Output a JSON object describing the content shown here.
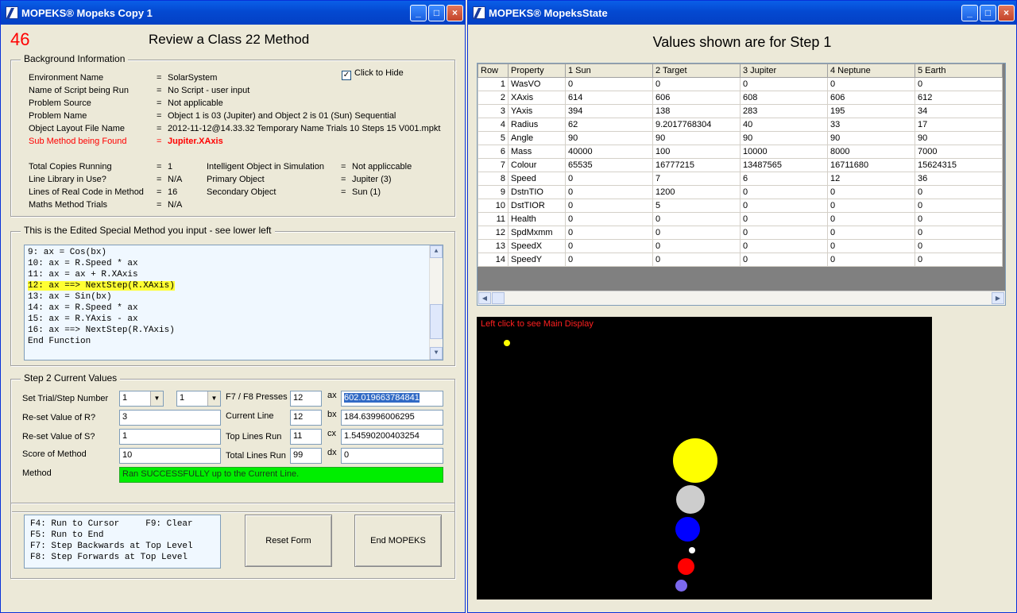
{
  "left_window": {
    "title": "MOPEKS® Mopeks Copy 1",
    "counter": "46",
    "heading": "Review a Class 22 Method",
    "background": {
      "legend": "Background Information",
      "hide_label": "Click to Hide",
      "rows": [
        {
          "label": "Environment Name",
          "value": "SolarSystem"
        },
        {
          "label": "Name of Script being Run",
          "value": "No Script - user input"
        },
        {
          "label": "Problem Source",
          "value": "Not applicable"
        },
        {
          "label": "Problem Name",
          "value": "Object 1 is 03 (Jupiter) and Object 2 is 01 (Sun) Sequential"
        },
        {
          "label": "Object Layout File Name",
          "value": "2012-11-12@14.33.32 Temporary Name Trials 10 Steps 15 V001.mpkt"
        },
        {
          "label": "Sub Method being Found",
          "value": "Jupiter.XAxis"
        }
      ],
      "stats_left": [
        {
          "label": "Total Copies Running",
          "value": "1"
        },
        {
          "label": "Line Library in Use?",
          "value": "N/A"
        },
        {
          "label": "Lines of Real Code in Method",
          "value": "16"
        },
        {
          "label": "Maths Method Trials",
          "value": "N/A"
        }
      ],
      "stats_right": [
        {
          "label": "Intelligent Object in Simulation",
          "value": "Not appliccable"
        },
        {
          "label": "Primary Object",
          "value": "Jupiter (3)"
        },
        {
          "label": "Secondary Object",
          "value": "Sun (1)"
        }
      ]
    },
    "method": {
      "legend": "This is the Edited Special Method you input - see lower left",
      "lines": [
        "9: ax = Cos(bx)",
        "10: ax = R.Speed * ax",
        "11: ax = ax + R.XAxis",
        "12: ax ==> NextStep(R.XAxis)",
        "13: ax = Sin(bx)",
        "14: ax = R.Speed * ax",
        "15: ax = R.YAxis - ax",
        "16: ax ==> NextStep(R.YAxis)",
        "End Function"
      ]
    },
    "step": {
      "legend": "Step 2   Current Values",
      "set_trial_label": "Set Trial/Step Number",
      "trial_value": "1",
      "step_value": "1",
      "reset_r_label": "Re-set Value of R?",
      "reset_r_value": "3",
      "reset_s_label": "Re-set Value of S?",
      "reset_s_value": "1",
      "score_label": "Score of Method",
      "score_value": "10",
      "method_label": "Method",
      "method_status": "Ran SUCCESSFULLY up to the Current Line.",
      "f7f8_label": "F7 / F8 Presses",
      "f7f8_value": "12",
      "current_line_label": "Current Line",
      "current_line_value": "12",
      "top_lines_label": "Top Lines Run",
      "top_lines_value": "11",
      "total_lines_label": "Total Lines Run",
      "total_lines_value": "99",
      "ax_label": "ax",
      "ax_value": "602.019663784841",
      "bx_label": "bx",
      "bx_value": "184.63996006295",
      "cx_label": "cx",
      "cx_value": "1.54590200403254",
      "dx_label": "dx",
      "dx_value": "0"
    },
    "keys": {
      "lines": [
        "F4: Run to Cursor     F9: Clear",
        "F5: Run to End",
        "F7: Step Backwards at Top Level",
        "F8: Step Forwards at Top Level"
      ],
      "reset_button": "Reset Form",
      "end_button": "End MOPEKS"
    }
  },
  "right_window": {
    "title": "MOPEKS® MopeksState",
    "heading": "Values shown are for Step 1",
    "columns": [
      "Row",
      "Property",
      "1 Sun",
      "2 Target",
      "3 Jupiter",
      "4 Neptune",
      "5 Earth"
    ],
    "rows": [
      [
        "1",
        "WasVO",
        "0",
        "0",
        "0",
        "0",
        "0"
      ],
      [
        "2",
        "XAxis",
        "614",
        "606",
        "608",
        "606",
        "612"
      ],
      [
        "3",
        "YAxis",
        "394",
        "138",
        "283",
        "195",
        "34"
      ],
      [
        "4",
        "Radius",
        "62",
        "9.2017768304",
        "40",
        "33",
        "17"
      ],
      [
        "5",
        "Angle",
        "90",
        "90",
        "90",
        "90",
        "90"
      ],
      [
        "6",
        "Mass",
        "40000",
        "100",
        "10000",
        "8000",
        "7000"
      ],
      [
        "7",
        "Colour",
        "65535",
        "16777215",
        "13487565",
        "16711680",
        "15624315"
      ],
      [
        "8",
        "Speed",
        "0",
        "7",
        "6",
        "12",
        "36"
      ],
      [
        "9",
        "DstnTIO",
        "0",
        "1200",
        "0",
        "0",
        "0"
      ],
      [
        "10",
        "DstTIOR",
        "0",
        "5",
        "0",
        "0",
        "0"
      ],
      [
        "11",
        "Health",
        "0",
        "0",
        "0",
        "0",
        "0"
      ],
      [
        "12",
        "SpdMxmm",
        "0",
        "0",
        "0",
        "0",
        "0"
      ],
      [
        "13",
        "SpeedX",
        "0",
        "0",
        "0",
        "0",
        "0"
      ],
      [
        "14",
        "SpeedY",
        "0",
        "0",
        "0",
        "0",
        "0"
      ]
    ],
    "display_hint": "Left click to see Main Display"
  }
}
